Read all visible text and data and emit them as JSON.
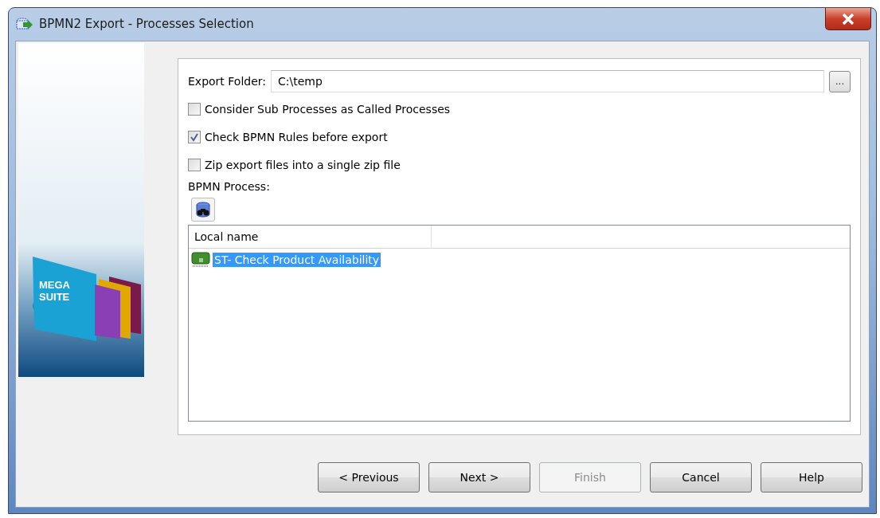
{
  "window": {
    "title": "BPMN2 Export - Processes Selection"
  },
  "logo": {
    "lines": [
      "MEGA",
      "SUITE"
    ]
  },
  "export_folder": {
    "label": "Export Folder:",
    "value": "C:\\temp",
    "browse_label": "..."
  },
  "options": [
    {
      "label": "Consider Sub Processes as Called Processes",
      "checked": false
    },
    {
      "label": "Check BPMN Rules before export",
      "checked": true
    },
    {
      "label": "Zip export files into a single zip file",
      "checked": false
    }
  ],
  "process_label": "BPMN Process:",
  "table": {
    "columns": [
      "Local name"
    ],
    "rows": [
      {
        "name": "ST- Check Product Availability",
        "selected": true
      }
    ]
  },
  "buttons": [
    {
      "label": "< Previous",
      "disabled": false
    },
    {
      "label": "Next >",
      "disabled": false
    },
    {
      "label": "Finish",
      "disabled": true
    },
    {
      "label": "Cancel",
      "disabled": false
    },
    {
      "label": "Help",
      "disabled": false
    }
  ]
}
